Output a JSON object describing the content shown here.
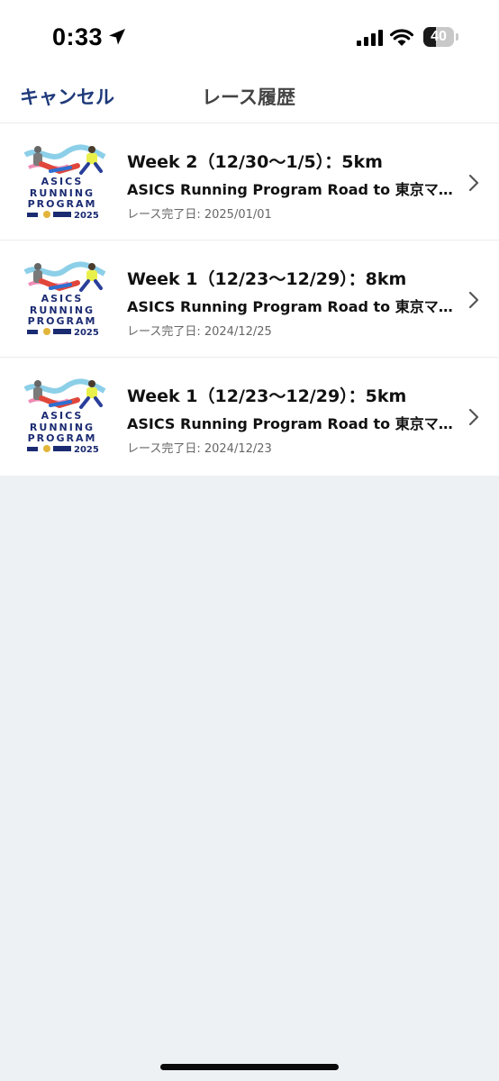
{
  "status_bar": {
    "time": "0:33",
    "battery_level": 40,
    "battery_text": "40",
    "icons": [
      "location-arrow-icon",
      "cellular-signal-icon",
      "wifi-icon",
      "battery-icon"
    ]
  },
  "nav": {
    "cancel_label": "キャンセル",
    "title": "レース履歴"
  },
  "races": [
    {
      "title": "Week 2（12/30〜1/5）：5km",
      "program": "ASICS Running Program Road to 東京マラソン",
      "date": "レース完了日: 2025/01/01",
      "thumb_lines": [
        "ASICS",
        "RUNNING",
        "PROGRAM"
      ],
      "thumb_year": "2025"
    },
    {
      "title": "Week 1（12/23〜12/29）：8km",
      "program": "ASICS Running Program Road to 東京マラソン",
      "date": "レース完了日: 2024/12/25",
      "thumb_lines": [
        "ASICS",
        "RUNNING",
        "PROGRAM"
      ],
      "thumb_year": "2025"
    },
    {
      "title": "Week 1（12/23〜12/29）：5km",
      "program": "ASICS Running Program Road to 東京マラソン",
      "date": "レース完了日: 2024/12/23",
      "thumb_lines": [
        "ASICS",
        "RUNNING",
        "PROGRAM"
      ],
      "thumb_year": "2025"
    }
  ],
  "colors": {
    "accent": "#1f3a7a",
    "background": "#eef1f4",
    "thumb_navy": "#1b2b72"
  }
}
